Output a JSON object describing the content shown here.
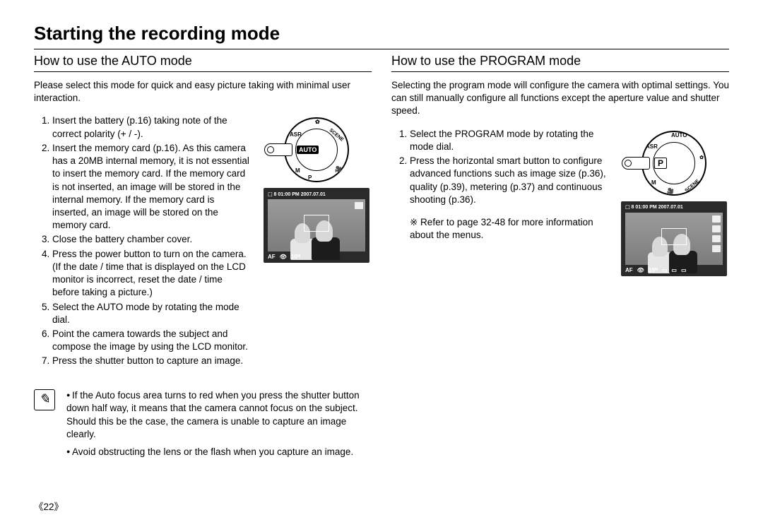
{
  "page": {
    "title": "Starting the recording mode",
    "number": "《22》"
  },
  "left": {
    "heading": "How to use the AUTO mode",
    "intro": "Please select this mode for quick and easy picture taking with minimal user interaction.",
    "steps": [
      "Insert the battery (p.16) taking note of the correct polarity (+ / -).",
      "Insert the memory card (p.16). As this camera has a 20MB internal memory, it is not essential to insert the memory card. If the memory card is not inserted, an image will be stored in the internal memory. If the memory card is inserted, an image will be stored on the memory card.",
      "Close the battery chamber cover.",
      "Press the power button to turn on the camera. (If the date / time that is displayed on the LCD monitor is incorrect, reset the date / time before taking a picture.)",
      "Select the AUTO mode by rotating the mode dial.",
      "Point the camera towards the subject and compose the image by using the LCD monitor.",
      "Press the shutter button to capture an image."
    ],
    "dial_label": "AUTO",
    "lcd_top": "⬚  8  01:00 PM 2007.07.01",
    "lcd_bottom_af": "AF",
    "lcd_bottom_eye": "👁",
    "lcd_bottom_val": "10ᴹ"
  },
  "right": {
    "heading": "How to use the PROGRAM mode",
    "intro": "Selecting the program mode will configure the camera with optimal settings. You can still manually configure all functions except the aperture value and shutter speed.",
    "steps": [
      "Select the PROGRAM mode by rotating the mode dial.",
      "Press the horizontal smart button to configure advanced functions such as image size (p.36), quality (p.39), metering (p.37) and continuous shooting (p.36)."
    ],
    "reference": "※ Refer to page 32-48 for more information about the menus.",
    "dial_label": "P",
    "lcd_top": "⬚  8  01:00 PM 2007.07.01",
    "lcd_bottom_af": "AF",
    "lcd_bottom_eye": "👁",
    "lcd_bottom_val": "10ᴹ"
  },
  "notes": {
    "items": [
      "If the Auto focus area turns to red when you press the shutter button down half way, it means that the camera cannot focus on the subject. Should this be the case, the camera is unable to capture an image clearly.",
      "Avoid obstructing the lens or the flash when you capture an image."
    ]
  }
}
